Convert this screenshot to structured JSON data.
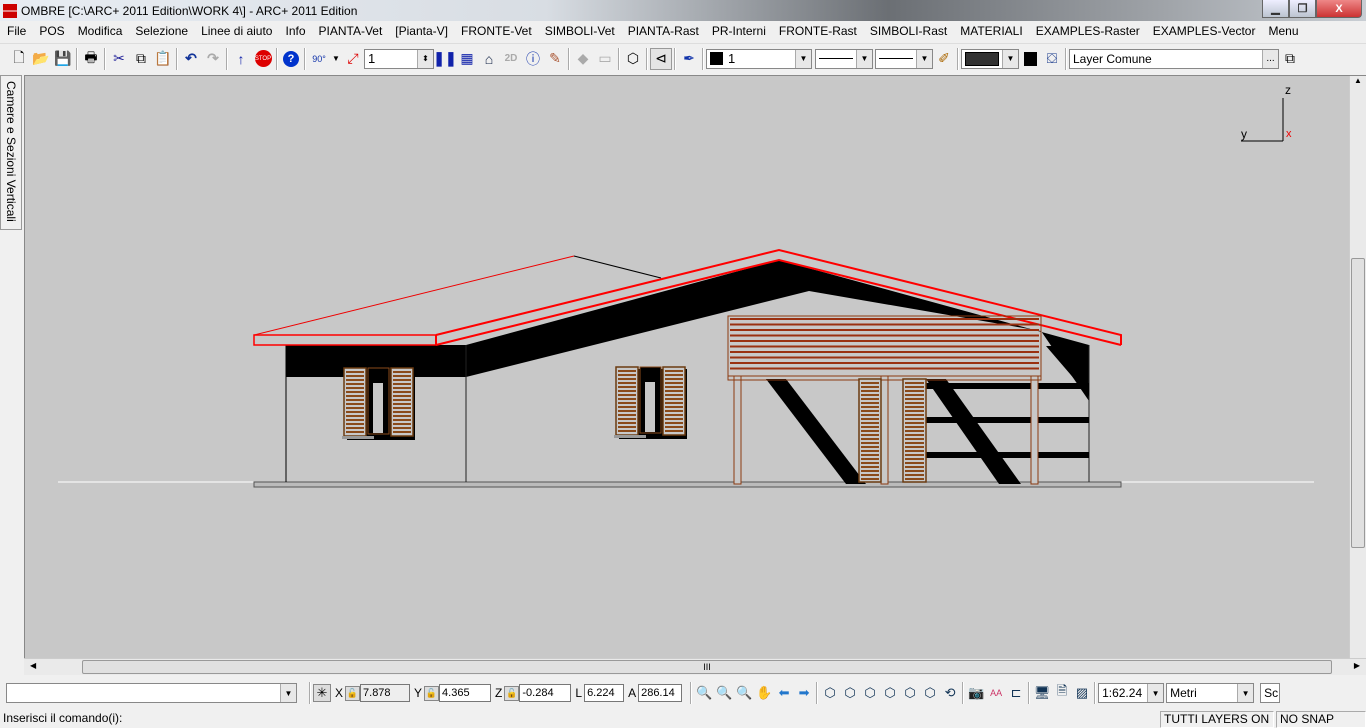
{
  "window": {
    "title": "OMBRE [C:\\ARC+ 2011 Edition\\WORK 4\\] - ARC+ 2011 Edition",
    "minimize": "▁",
    "restore": "❐",
    "close": "X"
  },
  "menu": [
    "File",
    "POS",
    "Modifica",
    "Selezione",
    "Linee di aiuto",
    "Info",
    "PIANTA-Vet",
    "[Pianta-V]",
    "FRONTE-Vet",
    "SIMBOLI-Vet",
    "PIANTA-Rast",
    "PR-Interni",
    "FRONTE-Rast",
    "SIMBOLI-Rast",
    "MATERIALI",
    "EXAMPLES-Raster",
    "EXAMPLES-Vector",
    "Menu"
  ],
  "toolbar": {
    "rotation_label": "90°",
    "step_value": "1",
    "color_value": "1",
    "layer_value": "Layer Comune",
    "layer_browse": "..."
  },
  "side_panel": {
    "label": "Camere e Sezioni Verticali"
  },
  "axes": {
    "z": "z",
    "y": "y",
    "x": "x"
  },
  "coords": {
    "x_label": "X",
    "x": "7.878",
    "y_label": "Y",
    "y": "4.365",
    "z_label": "Z",
    "z": "-0.284",
    "l_label": "L",
    "l": "6.224",
    "a_label": "A",
    "a": "286.14"
  },
  "bottom": {
    "command_value": "",
    "scale": "1:62.24",
    "units": "Metri",
    "extra": "Sc",
    "scroll_grip": "III"
  },
  "status": {
    "prompt": "Inserisci il comando(i):",
    "layers": "TUTTI LAYERS ON",
    "snap": "NO SNAP"
  },
  "colors": {
    "roof_edge": "#ff0000",
    "wood": "#8b3a10",
    "shadow": "#000000",
    "canvas": "#c8c8c8"
  }
}
